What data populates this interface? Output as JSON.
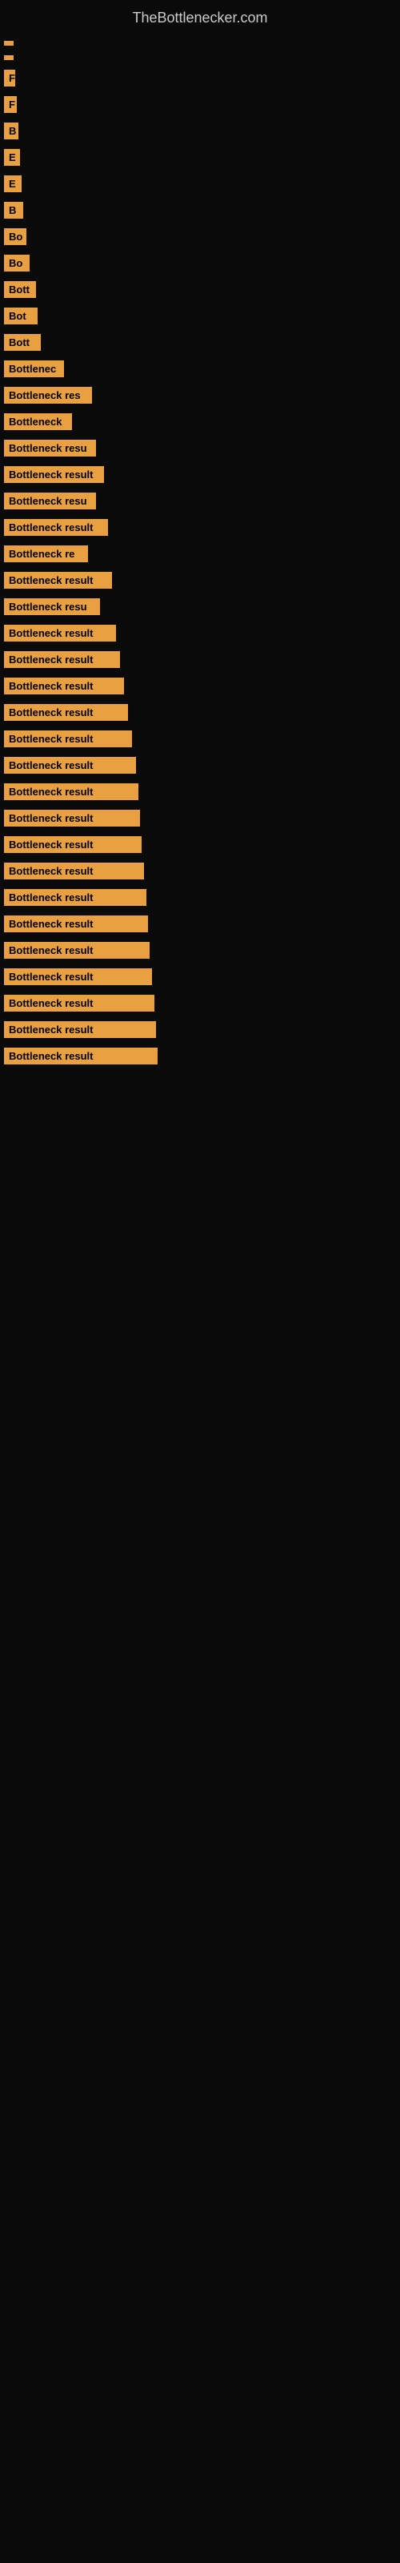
{
  "site": {
    "title": "TheBottlenecker.com"
  },
  "bars": [
    {
      "label": "",
      "width": 8
    },
    {
      "label": "",
      "width": 10
    },
    {
      "label": "F",
      "width": 14
    },
    {
      "label": "F",
      "width": 16
    },
    {
      "label": "B",
      "width": 18
    },
    {
      "label": "E",
      "width": 20
    },
    {
      "label": "E",
      "width": 22
    },
    {
      "label": "B",
      "width": 24
    },
    {
      "label": "Bo",
      "width": 28
    },
    {
      "label": "Bo",
      "width": 32
    },
    {
      "label": "Bott",
      "width": 40
    },
    {
      "label": "Bot",
      "width": 42
    },
    {
      "label": "Bott",
      "width": 46
    },
    {
      "label": "Bottlenec",
      "width": 75
    },
    {
      "label": "Bottleneck res",
      "width": 110
    },
    {
      "label": "Bottleneck",
      "width": 85
    },
    {
      "label": "Bottleneck resu",
      "width": 115
    },
    {
      "label": "Bottleneck result",
      "width": 125
    },
    {
      "label": "Bottleneck resu",
      "width": 115
    },
    {
      "label": "Bottleneck result",
      "width": 130
    },
    {
      "label": "Bottleneck re",
      "width": 105
    },
    {
      "label": "Bottleneck result",
      "width": 135
    },
    {
      "label": "Bottleneck resu",
      "width": 120
    },
    {
      "label": "Bottleneck result",
      "width": 140
    },
    {
      "label": "Bottleneck result",
      "width": 145
    },
    {
      "label": "Bottleneck result",
      "width": 150
    },
    {
      "label": "Bottleneck result",
      "width": 155
    },
    {
      "label": "Bottleneck result",
      "width": 160
    },
    {
      "label": "Bottleneck result",
      "width": 165
    },
    {
      "label": "Bottleneck result",
      "width": 168
    },
    {
      "label": "Bottleneck result",
      "width": 170
    },
    {
      "label": "Bottleneck result",
      "width": 172
    },
    {
      "label": "Bottleneck result",
      "width": 175
    },
    {
      "label": "Bottleneck result",
      "width": 178
    },
    {
      "label": "Bottleneck result",
      "width": 180
    },
    {
      "label": "Bottleneck result",
      "width": 182
    },
    {
      "label": "Bottleneck result",
      "width": 185
    },
    {
      "label": "Bottleneck result",
      "width": 188
    },
    {
      "label": "Bottleneck result",
      "width": 190
    },
    {
      "label": "Bottleneck result",
      "width": 192
    }
  ]
}
